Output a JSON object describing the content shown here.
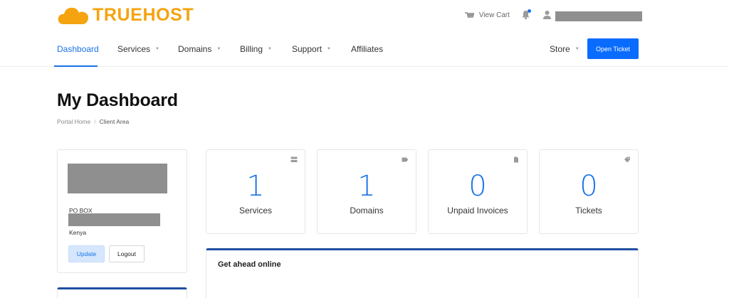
{
  "brand": {
    "name": "TRUEHOST",
    "color": "#f5a30f"
  },
  "header": {
    "view_cart_label": "View Cart",
    "notification_has_unread": true,
    "user_name": ""
  },
  "nav": {
    "items": [
      {
        "label": "Dashboard",
        "active": true,
        "dropdown": false
      },
      {
        "label": "Services",
        "active": false,
        "dropdown": true
      },
      {
        "label": "Domains",
        "active": false,
        "dropdown": true
      },
      {
        "label": "Billing",
        "active": false,
        "dropdown": true
      },
      {
        "label": "Support",
        "active": false,
        "dropdown": true
      },
      {
        "label": "Affiliates",
        "active": false,
        "dropdown": false
      }
    ],
    "store_label": "Store",
    "open_ticket_label": "Open Ticket",
    "accent_color": "#1a73e8"
  },
  "page": {
    "title": "My Dashboard",
    "breadcrumb": [
      {
        "label": "Portal Home"
      },
      {
        "label": "Client Area"
      }
    ]
  },
  "client": {
    "address_line1": "PO BOX",
    "country": "Kenya",
    "update_label": "Update",
    "logout_label": "Logout"
  },
  "stats": [
    {
      "value": "1",
      "label": "Services",
      "icon": "server-icon"
    },
    {
      "value": "1",
      "label": "Domains",
      "icon": "tag-icon"
    },
    {
      "value": "0",
      "label": "Unpaid Invoices",
      "icon": "document-icon"
    },
    {
      "value": "0",
      "label": "Tickets",
      "icon": "ticket-icon"
    }
  ],
  "promo": {
    "title": "Get ahead online"
  }
}
